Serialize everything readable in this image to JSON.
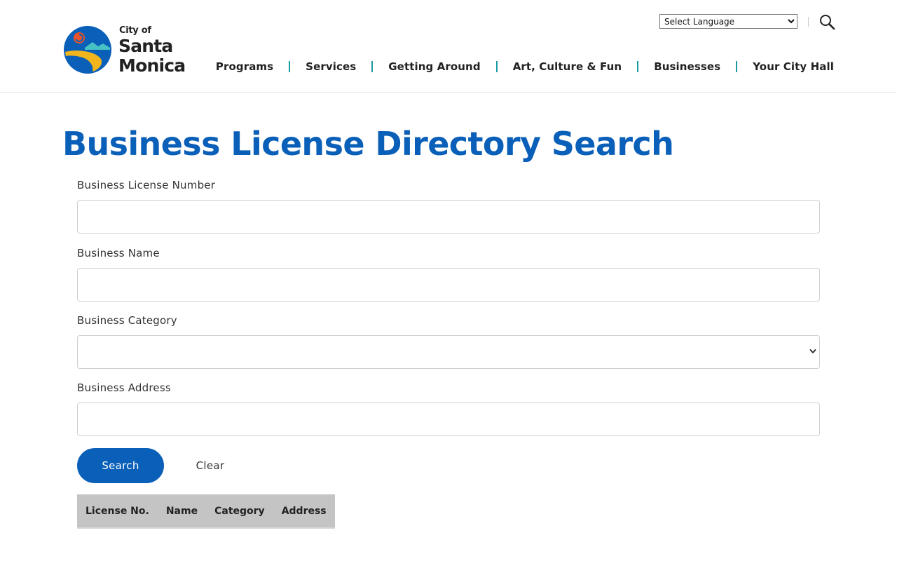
{
  "header": {
    "logo": {
      "line1": "City of",
      "line2": "Santa",
      "line3": "Monica",
      "colors": {
        "circle": "#0a5fb8",
        "sun": "#e8542a",
        "wave": "#f2b51d",
        "hill": "#46c1c4"
      }
    },
    "language_select": {
      "selected": "Select Language"
    },
    "search_icon": "search-icon",
    "nav": [
      {
        "label": "Programs"
      },
      {
        "label": "Services"
      },
      {
        "label": "Getting Around"
      },
      {
        "label": "Art, Culture & Fun"
      },
      {
        "label": "Businesses"
      },
      {
        "label": "Your City Hall"
      }
    ],
    "nav_separator_color": "#1a9aa3"
  },
  "main": {
    "title": "Business License Directory Search",
    "title_color": "#0a5fb8",
    "form": {
      "license_number": {
        "label": "Business License Number",
        "value": "",
        "placeholder": ""
      },
      "business_name": {
        "label": "Business Name",
        "value": "",
        "placeholder": ""
      },
      "business_category": {
        "label": "Business Category",
        "selected": ""
      },
      "business_address": {
        "label": "Business Address",
        "value": "",
        "placeholder": ""
      }
    },
    "buttons": {
      "search": "Search",
      "clear": "Clear"
    },
    "button_color": "#0a5fb8",
    "table": {
      "columns": [
        "License No.",
        "Name",
        "Category",
        "Address"
      ],
      "rows": []
    }
  }
}
